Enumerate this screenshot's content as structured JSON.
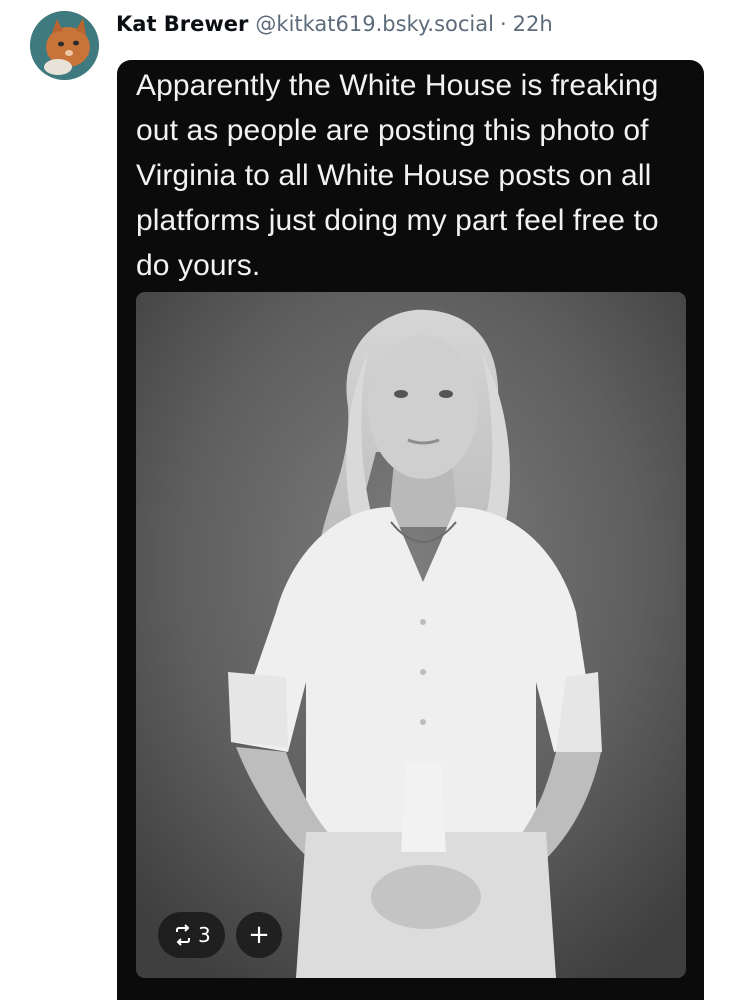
{
  "post": {
    "author_name": "Kat Brewer",
    "handle": "@kitkat619.bsky.social",
    "separator": "·",
    "time": "22h",
    "text": "Apparently the White House is freaking out as people are posting this photo of Virginia to all White House posts on all platforms just doing my part feel free to do yours.",
    "image_overlay": {
      "repost_icon": "repost-icon",
      "repost_count": "3",
      "plus_label": "+"
    }
  },
  "colors": {
    "card_background": "#0b0b0c",
    "text_on_card": "#f2f2f2",
    "handle_gray": "#5d6b7a"
  }
}
